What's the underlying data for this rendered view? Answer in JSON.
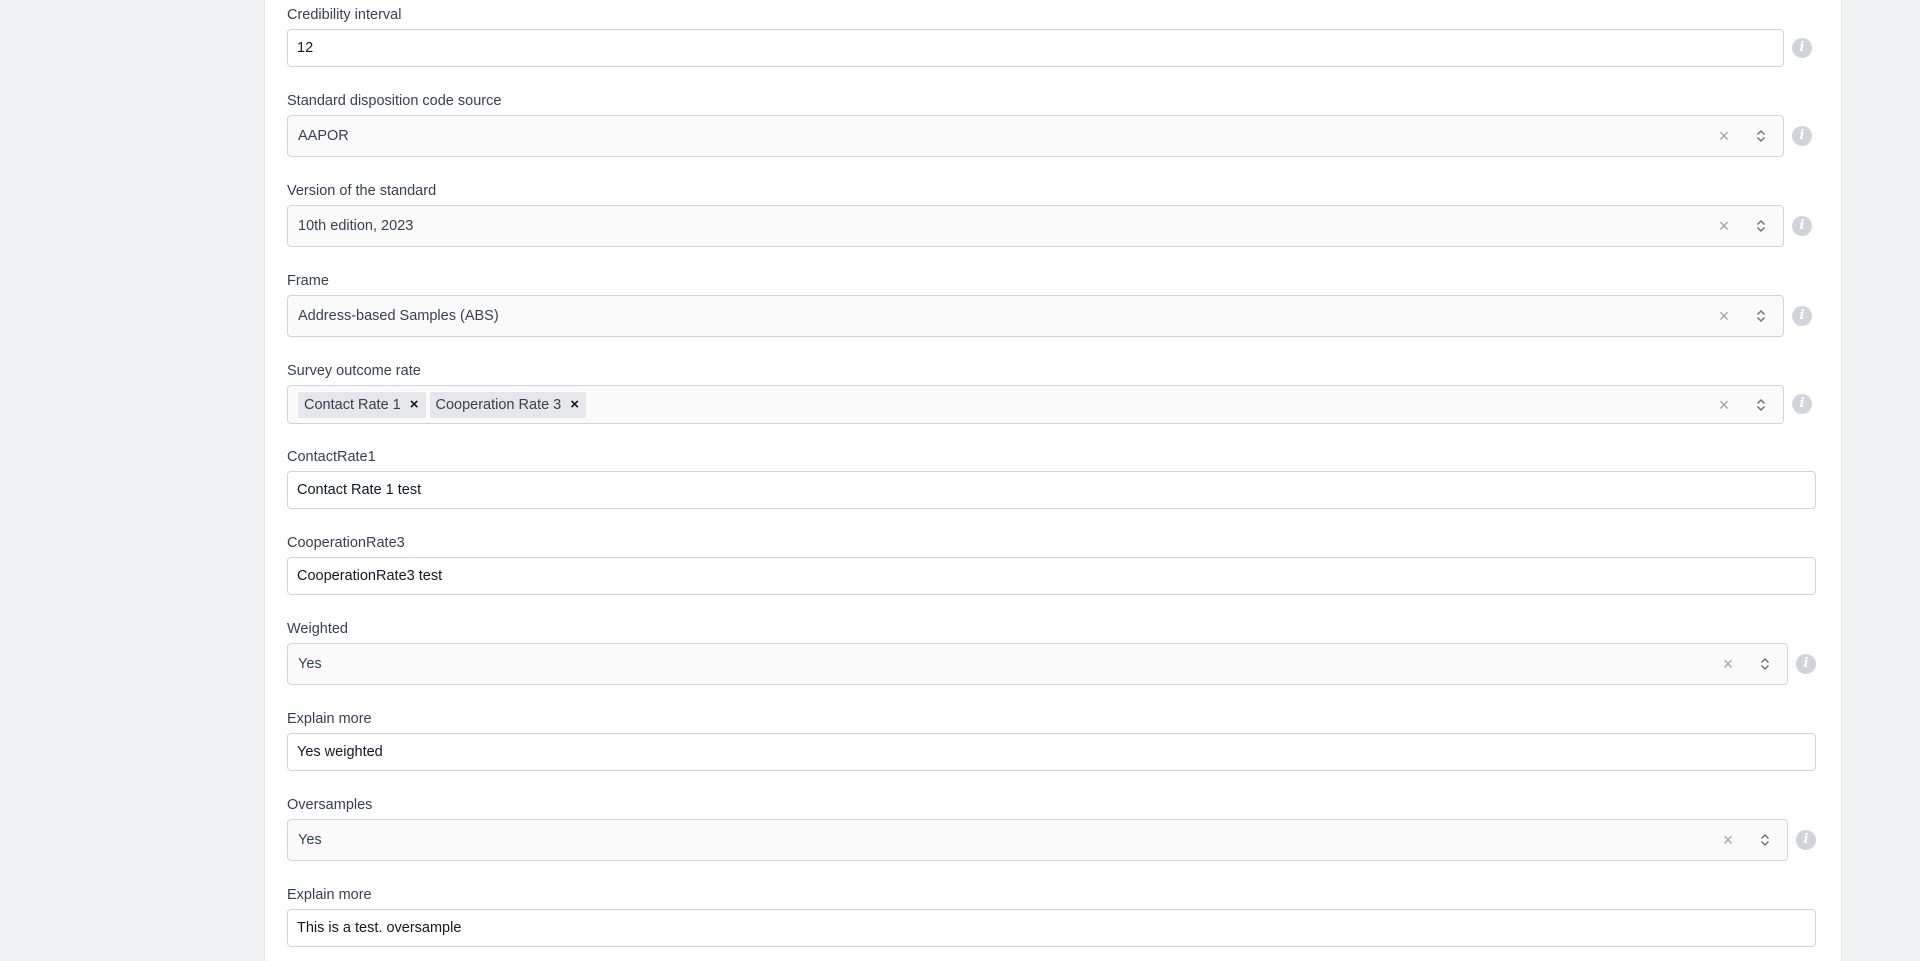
{
  "fields": {
    "credibility_interval": {
      "label": "Credibility interval",
      "value": "12"
    },
    "disposition_source": {
      "label": "Standard disposition code source",
      "value": "AAPOR"
    },
    "standard_version": {
      "label": "Version of the standard",
      "value": "10th edition, 2023"
    },
    "frame": {
      "label": "Frame",
      "value": "Address-based Samples (ABS)"
    },
    "survey_outcome_rate": {
      "label": "Survey outcome rate",
      "chips": [
        "Contact Rate 1",
        "Cooperation Rate 3"
      ]
    },
    "contact_rate1": {
      "label": "ContactRate1",
      "value": "Contact Rate 1 test"
    },
    "cooperation_rate3": {
      "label": "CooperationRate3",
      "value": "CooperationRate3 test"
    },
    "weighted": {
      "label": "Weighted",
      "value": "Yes"
    },
    "weighted_explain": {
      "label": "Explain more",
      "value": "Yes weighted"
    },
    "oversamples": {
      "label": "Oversamples",
      "value": "Yes"
    },
    "oversamples_explain": {
      "label": "Explain more",
      "value": "This is a test. oversample"
    }
  },
  "icons": {
    "info": "info-icon",
    "clear": "clear-icon",
    "chevron": "chevron-up-down-icon",
    "chip_remove": "remove-chip-icon"
  },
  "glyphs": {
    "clear": "×",
    "chip_remove": "×",
    "info": "i"
  },
  "colors": {
    "background": "#f1f2f4",
    "panel": "#ffffff",
    "border": "#d1d5db",
    "info_icon": "#d1d5db"
  }
}
